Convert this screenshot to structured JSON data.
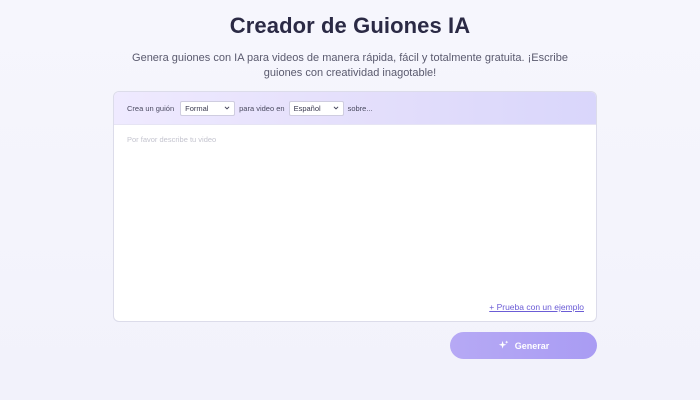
{
  "header": {
    "title": "Creador de Guiones IA",
    "subtitle": "Genera guiones con IA para videos de manera rápida, fácil y totalmente gratuita. ¡Escribe guiones con creatividad inagotable!"
  },
  "options": {
    "prefix": "Crea un guión",
    "tone_value": "Formal",
    "middle": "para video en",
    "language_value": "Español",
    "suffix": "sobre..."
  },
  "editor": {
    "placeholder": "Por favor describe tu video",
    "example_link": "+ Prueba con un ejemplo"
  },
  "actions": {
    "generate_label": "Generar",
    "generate_icon": "sparkle-icon"
  },
  "colors": {
    "accent": "#a99cf3",
    "link": "#6b5cd6",
    "title": "#2b2a45"
  }
}
